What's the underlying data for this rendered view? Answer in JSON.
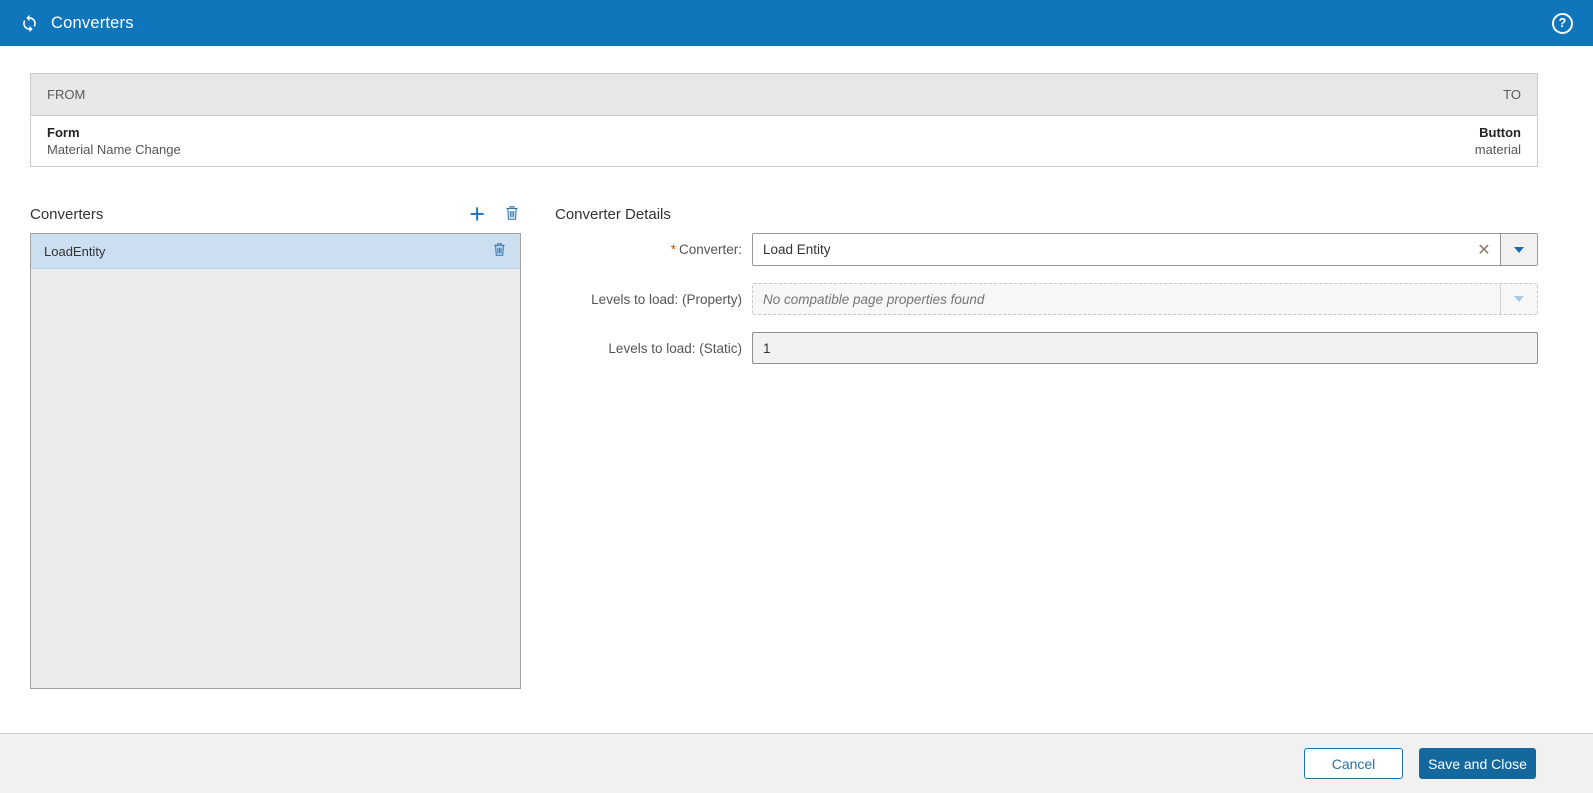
{
  "header": {
    "title": "Converters",
    "help_glyph": "?"
  },
  "mapping_table": {
    "from_header": "FROM",
    "to_header": "TO",
    "row": {
      "from_title": "Form",
      "from_subtitle": "Material Name Change",
      "to_title": "Button",
      "to_subtitle": "material"
    }
  },
  "converters_panel": {
    "title": "Converters",
    "add_glyph": "+",
    "items": [
      {
        "label": "LoadEntity"
      }
    ]
  },
  "details_panel": {
    "title": "Converter Details",
    "fields": {
      "converter": {
        "required_marker": "*",
        "label": "Converter:",
        "value": "Load Entity",
        "clear_glyph": "✕"
      },
      "levels_property": {
        "label": "Levels to load: (Property)",
        "placeholder": "No compatible page properties found",
        "value": ""
      },
      "levels_static": {
        "label": "Levels to load: (Static)",
        "value": "1"
      }
    }
  },
  "footer": {
    "cancel_label": "Cancel",
    "save_label": "Save and Close"
  },
  "colors": {
    "header_blue": "#0f76bc",
    "accent_blue": "#1b72b5",
    "selected_row_blue": "#cbdff0",
    "save_button_blue": "#15689e",
    "footer_gray": "#f1f1f1"
  }
}
